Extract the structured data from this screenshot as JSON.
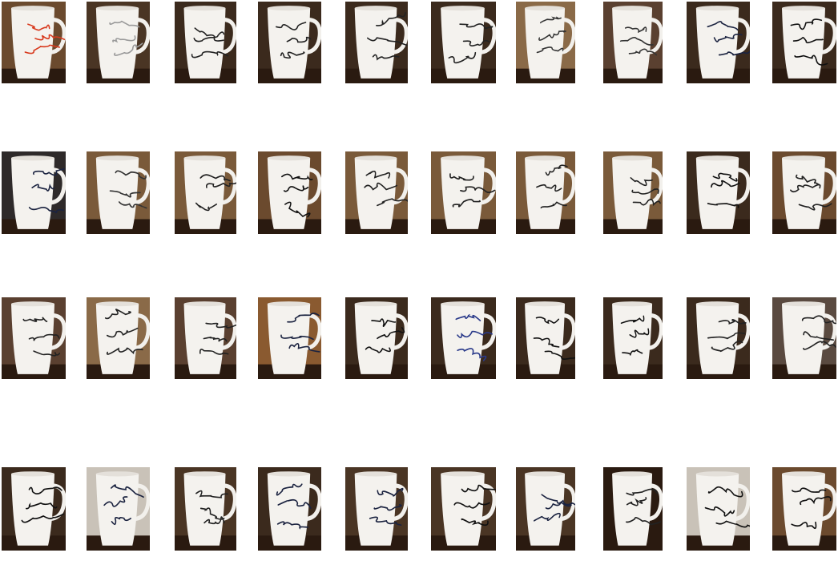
{
  "gallery": {
    "rows": [
      [
        {
          "ink": "#d83a1e",
          "bg": "#6b4a2e"
        },
        {
          "ink": "#9a9a9a",
          "bg": "#4a3524"
        },
        {
          "ink": "#222222",
          "bg": "#3b2a1d"
        },
        {
          "ink": "#222222",
          "bg": "#3b2a1d"
        },
        {
          "ink": "#222222",
          "bg": "#3b2a1d"
        },
        {
          "ink": "#222222",
          "bg": "#3b2a1d"
        },
        {
          "ink": "#333333",
          "bg": "#8a6a48"
        },
        {
          "ink": "#333333",
          "bg": "#5a4030"
        },
        {
          "ink": "#1b2340",
          "bg": "#3b2a1d"
        },
        {
          "ink": "#111111",
          "bg": "#3b2a1d"
        }
      ],
      [
        {
          "ink": "#1b2340",
          "bg": "#2e2a2a"
        },
        {
          "ink": "#333333",
          "bg": "#7a5a3a"
        },
        {
          "ink": "#222222",
          "bg": "#7a5a3a"
        },
        {
          "ink": "#111111",
          "bg": "#6b4a2e"
        },
        {
          "ink": "#222222",
          "bg": "#7a5a3a"
        },
        {
          "ink": "#222222",
          "bg": "#7a5a3a"
        },
        {
          "ink": "#222222",
          "bg": "#7a5a3a"
        },
        {
          "ink": "#222222",
          "bg": "#7a5a3a"
        },
        {
          "ink": "#111111",
          "bg": "#3b2a1d"
        },
        {
          "ink": "#222222",
          "bg": "#6b4a2e"
        }
      ],
      [
        {
          "ink": "#222222",
          "bg": "#5a4030"
        },
        {
          "ink": "#222222",
          "bg": "#8a6a48"
        },
        {
          "ink": "#222222",
          "bg": "#5a4030"
        },
        {
          "ink": "#1b2340",
          "bg": "#8a5a30"
        },
        {
          "ink": "#111111",
          "bg": "#3b2a1d"
        },
        {
          "ink": "#2a3a8a",
          "bg": "#3b2a1d"
        },
        {
          "ink": "#111111",
          "bg": "#3b2a1d"
        },
        {
          "ink": "#111111",
          "bg": "#3b2a1d"
        },
        {
          "ink": "#222222",
          "bg": "#3b2a1d"
        },
        {
          "ink": "#222222",
          "bg": "#5a4a40"
        }
      ],
      [
        {
          "ink": "#111111",
          "bg": "#3b2a1d"
        },
        {
          "ink": "#1b2340",
          "bg": "#c9c2b8"
        },
        {
          "ink": "#222222",
          "bg": "#4a3524"
        },
        {
          "ink": "#1b2340",
          "bg": "#3b2a1d"
        },
        {
          "ink": "#1b2340",
          "bg": "#4a3524"
        },
        {
          "ink": "#111111",
          "bg": "#4a3524"
        },
        {
          "ink": "#1b2340",
          "bg": "#4a3524"
        },
        {
          "ink": "#222222",
          "bg": "#2a1a10"
        },
        {
          "ink": "#111111",
          "bg": "#c9c2b8"
        },
        {
          "ink": "#111111",
          "bg": "#6b4a2e"
        }
      ]
    ]
  }
}
